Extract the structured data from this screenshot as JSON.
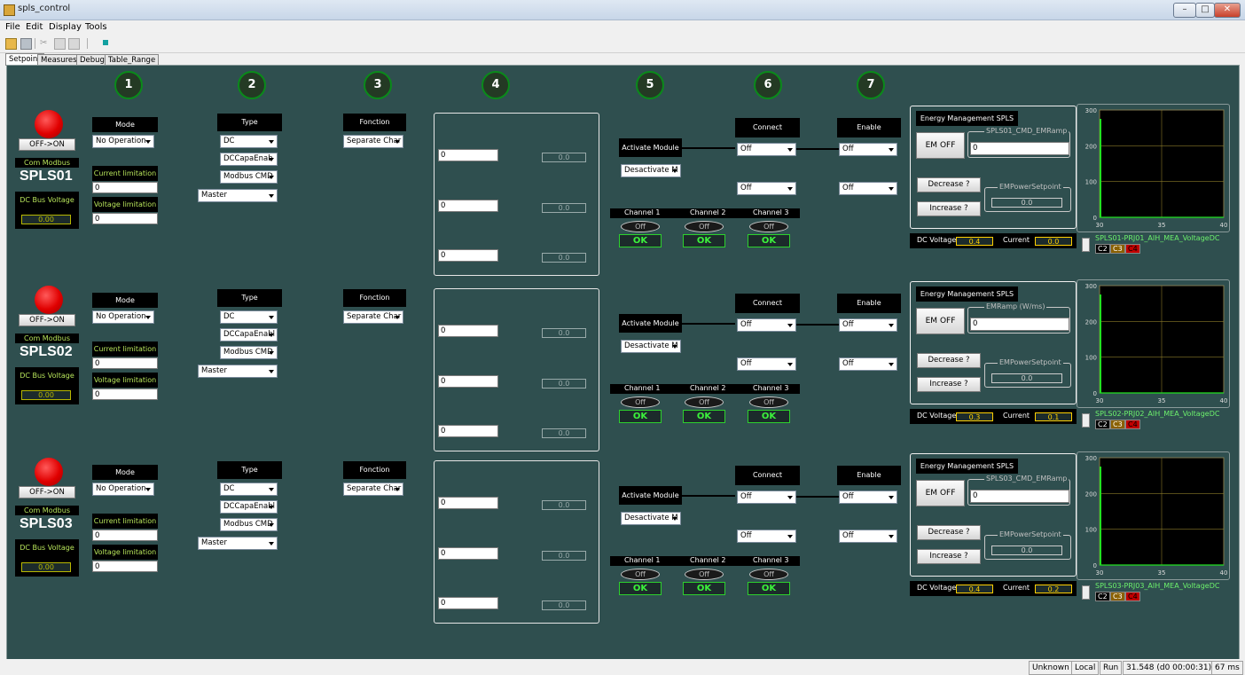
{
  "window": {
    "title": "spls_control"
  },
  "menu": [
    "File",
    "Edit",
    "Display",
    "Tools"
  ],
  "tabs": [
    "Setpoint",
    "Measures",
    "Debug",
    "Table_Range"
  ],
  "steps": [
    "1",
    "2",
    "3",
    "4",
    "5",
    "6",
    "7"
  ],
  "status": [
    "Unknown",
    "Local",
    "Run",
    "31.548 (d0 00:00:31)",
    "67 ms"
  ],
  "labels": {
    "off_on": "OFF->ON",
    "com_modbus": "Com Modbus",
    "dc_bus_voltage": "DC Bus Voltage",
    "mode": "Mode",
    "current_limitation": "Current limitation",
    "voltage_limitation": "Voltage limitation",
    "type": "Type",
    "fonction": "Fonction",
    "activate_module": "Activate Module",
    "connect": "Connect",
    "enable": "Enable",
    "energy_management": "Energy Management SPLS",
    "em_off": "EM OFF",
    "decrease": "Decrease ?",
    "increase": "Increase ?",
    "empower": "EMPowerSetpoint",
    "dc_voltage": "DC Voltage",
    "current": "Current",
    "channel1": "Channel 1",
    "channel2": "Channel 2",
    "channel3": "Channel 3",
    "off": "Off",
    "ok": "OK",
    "c2": "C2",
    "c3": "C3",
    "c4": "C4"
  },
  "modules": [
    {
      "name": "SPLS01",
      "dc_bus_voltage": "0.00",
      "mode": "No Operation",
      "current_limitation": "0",
      "voltage_limitation": "0",
      "type_dc": "DC",
      "type_capa": "DCCapaEnab",
      "type_modbus": "Modbus CMD",
      "type_master": "Master",
      "fonction": "Separate Char",
      "setpoints": [
        "0",
        "0",
        "0"
      ],
      "setpoint_readouts": [
        "0.0",
        "0.0",
        "0.0"
      ],
      "activate_select": "Desactivate M",
      "connect1": "Off",
      "connect2": "Off",
      "enable1": "Off",
      "enable2": "Off",
      "em_group": "SPLS01_CMD_EMRamp",
      "em_value": "0",
      "empower_value": "0.0",
      "dc_voltage": "0.4",
      "current": "0.0",
      "trend_name": "SPLS01-PRJ01_AIH_MEA_VoltageDC",
      "chart_data": {
        "type": "line",
        "x": [
          30,
          40
        ],
        "y": [
          0,
          0
        ],
        "xticks": [
          "30",
          "35",
          "40"
        ],
        "yticks": [
          "300",
          "200",
          "100",
          "0"
        ],
        "xlim": [
          30,
          40
        ],
        "ylim": [
          0,
          300
        ],
        "grid": true
      }
    },
    {
      "name": "SPLS02",
      "dc_bus_voltage": "0.00",
      "mode": "No Operation",
      "current_limitation": "0",
      "voltage_limitation": "0",
      "type_dc": "DC",
      "type_capa": "DCCapaEnabl",
      "type_modbus": "Modbus CMD",
      "type_master": "Master",
      "fonction": "Separate Char",
      "setpoints": [
        "0",
        "0",
        "0"
      ],
      "setpoint_readouts": [
        "0.0",
        "0.0",
        "0.0"
      ],
      "activate_select": "Desactivate M",
      "connect1": "Off",
      "connect2": "Off",
      "enable1": "Off",
      "enable2": "Off",
      "em_group": "EMRamp (W/ms)",
      "em_value": "0",
      "empower_value": "0.0",
      "dc_voltage": "0.3",
      "current": "0.1",
      "trend_name": "SPLS02-PRJ02_AIH_MEA_VoltageDC",
      "chart_data": {
        "type": "line",
        "x": [
          30,
          40
        ],
        "y": [
          0,
          0
        ],
        "xticks": [
          "30",
          "35",
          "40"
        ],
        "yticks": [
          "300",
          "200",
          "100",
          "0"
        ],
        "xlim": [
          30,
          40
        ],
        "ylim": [
          0,
          300
        ],
        "grid": true
      }
    },
    {
      "name": "SPLS03",
      "dc_bus_voltage": "0.00",
      "mode": "No Operation",
      "current_limitation": "0",
      "voltage_limitation": "0",
      "type_dc": "DC",
      "type_capa": "DCCapaEnabl",
      "type_modbus": "Modbus CMD",
      "type_master": "Master",
      "fonction": "Separate Char",
      "setpoints": [
        "0",
        "0",
        "0"
      ],
      "setpoint_readouts": [
        "0.0",
        "0.0",
        "0.0"
      ],
      "activate_select": "Desactivate M",
      "connect1": "Off",
      "connect2": "Off",
      "enable1": "Off",
      "enable2": "Off",
      "em_group": "SPLS03_CMD_EMRamp",
      "em_value": "0",
      "empower_value": "0.0",
      "dc_voltage": "0.4",
      "current": "0.2",
      "trend_name": "SPLS03-PRJ03_AIH_MEA_VoltageDC",
      "chart_data": {
        "type": "line",
        "x": [
          30,
          40
        ],
        "y": [
          0,
          0
        ],
        "xticks": [
          "30",
          "35",
          "40"
        ],
        "yticks": [
          "300",
          "200",
          "100",
          "0"
        ],
        "xlim": [
          30,
          40
        ],
        "ylim": [
          0,
          300
        ],
        "grid": true
      }
    }
  ]
}
